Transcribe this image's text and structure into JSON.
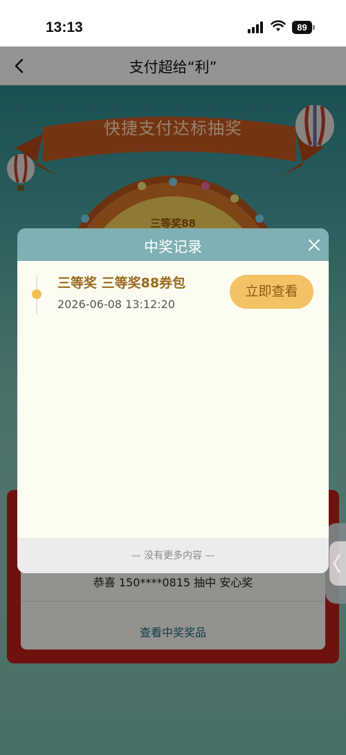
{
  "status_bar": {
    "time": "13:13",
    "battery": "89",
    "icons": [
      "cellular-signal-icon",
      "wifi-icon",
      "battery-icon"
    ]
  },
  "nav": {
    "title": "支付超给“利”",
    "back_icon": "chevron-left-icon"
  },
  "background": {
    "banner_title": "快捷支付达标抽奖",
    "wheel_label": "三等奖88",
    "winner_text": "恭喜 150****0815 抽中 安心奖",
    "view_prizes_link": "查看中奖奖品"
  },
  "modal": {
    "title": "中奖记录",
    "close_icon": "close-icon",
    "records": [
      {
        "title": "三等奖 三等奖88券包",
        "time": "2026-06-08 13:12:20",
        "action_label": "立即查看"
      }
    ],
    "footer_text": "— 没有更多内容 —"
  },
  "side_tab": {
    "icon": "chevron-left-icon"
  },
  "colors": {
    "modal_header": "#7fb0b3",
    "modal_body": "#fcfcf1",
    "accent_button": "#f3c265",
    "record_title": "#9a6a1e",
    "timeline_dot": "#f2bd52"
  }
}
